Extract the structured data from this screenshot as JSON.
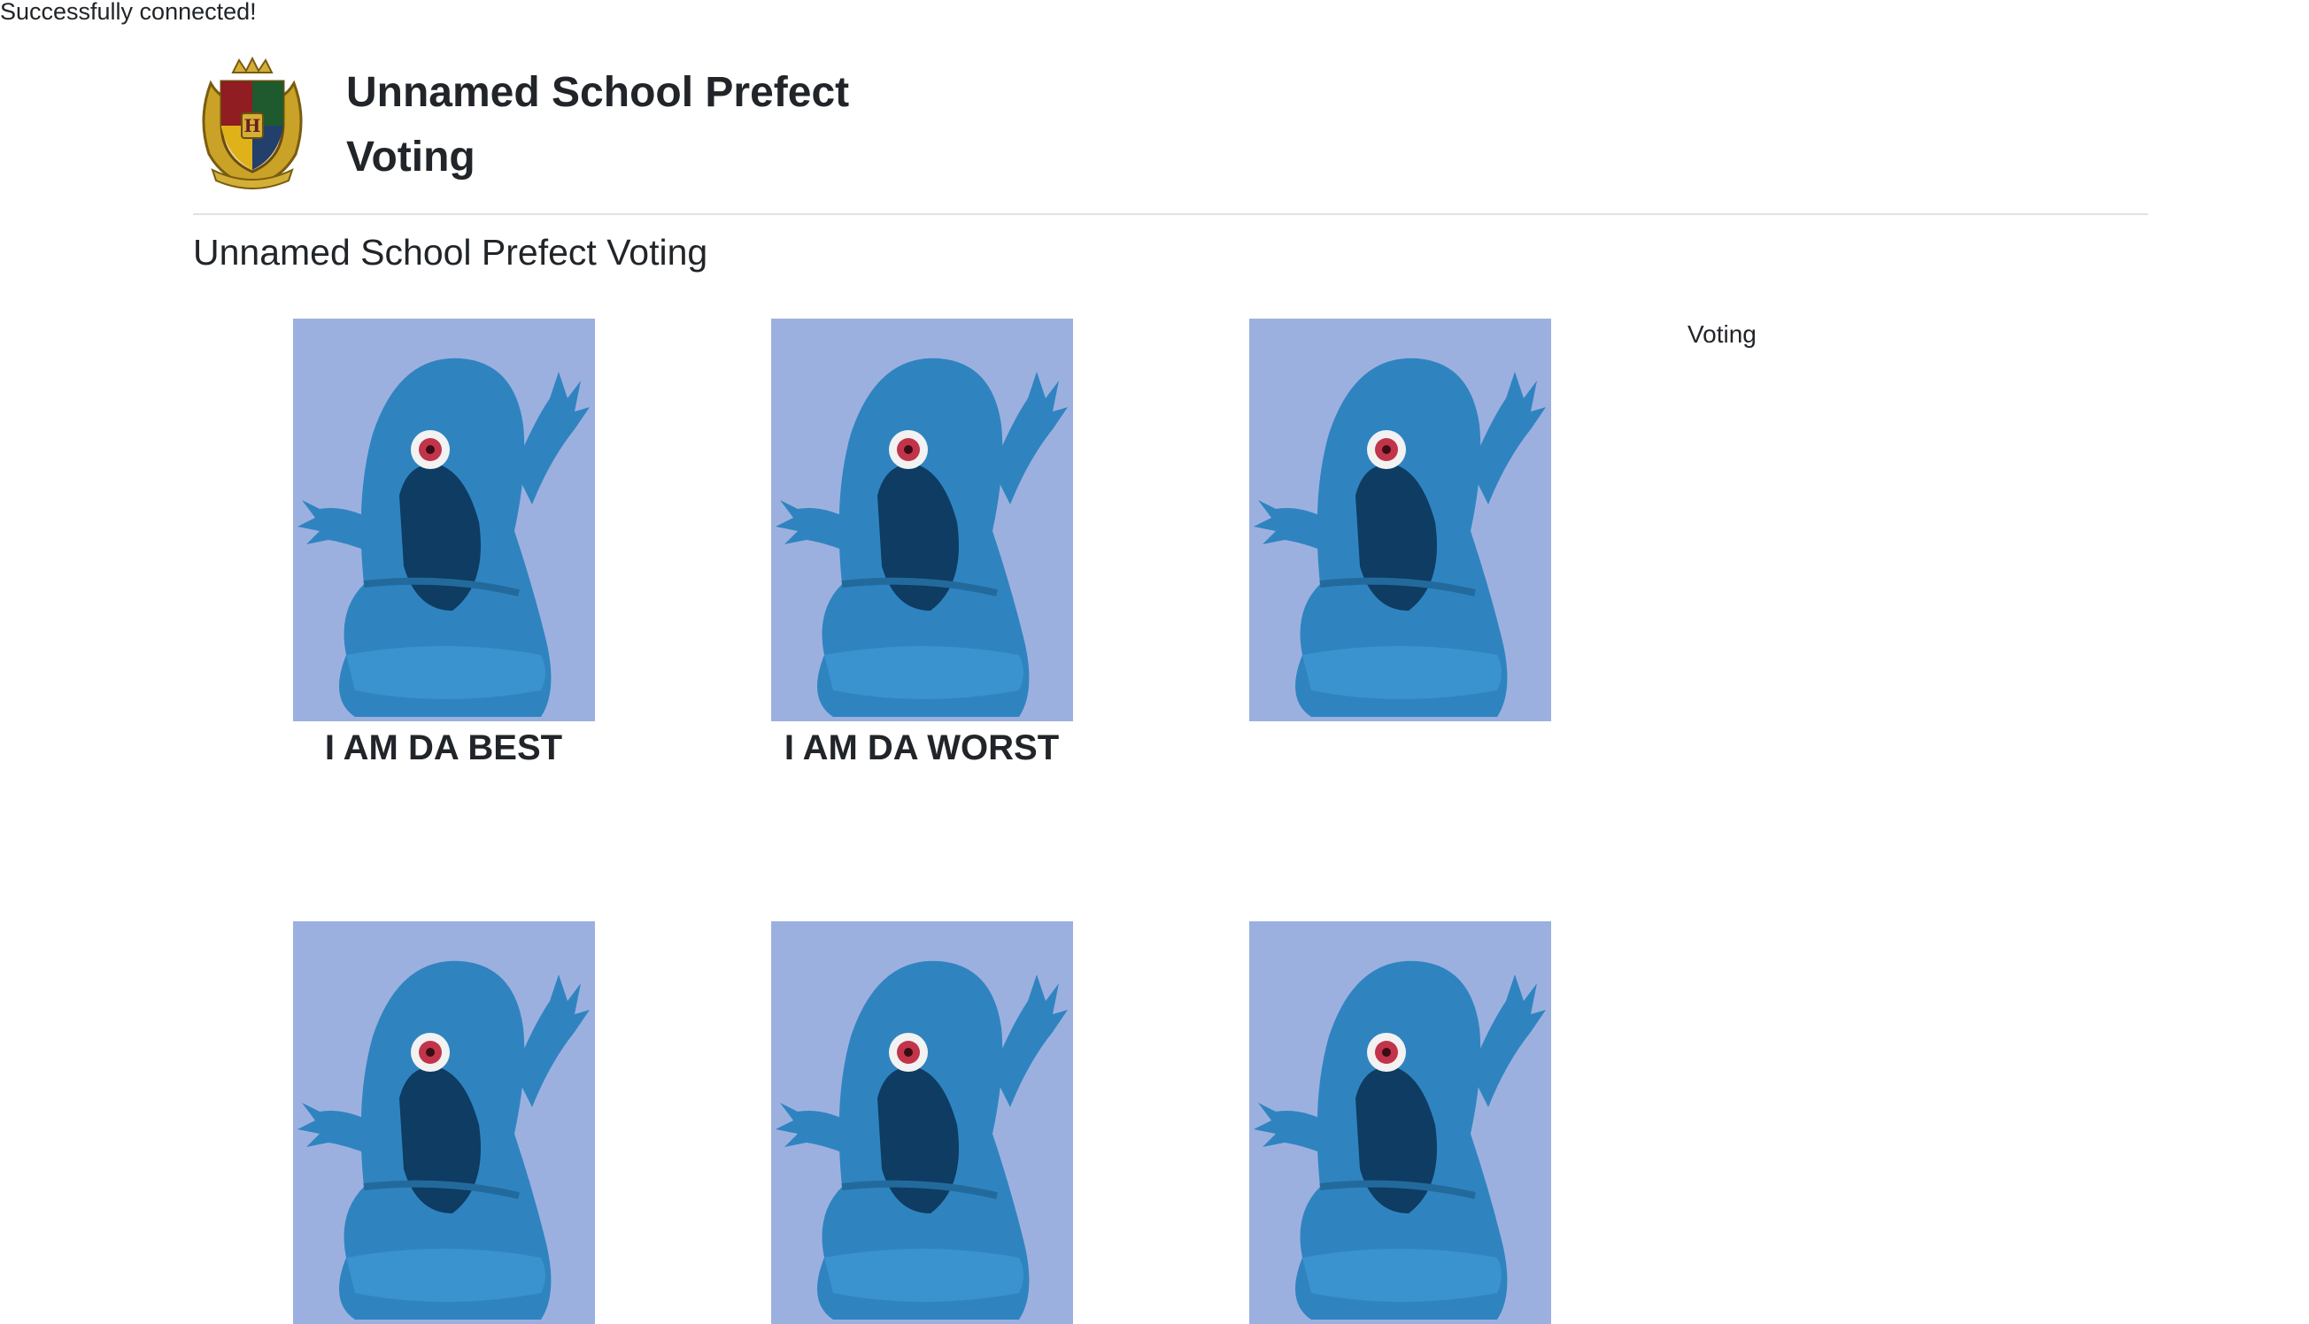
{
  "status": {
    "message": "Successfully connected!"
  },
  "header": {
    "title": "Unnamed School Prefect Voting",
    "logo_icon": "school-crest-icon"
  },
  "main": {
    "heading": "Unnamed School Prefect Voting",
    "side_label": "Voting",
    "candidates": [
      {
        "name": "I AM DA BEST",
        "photo_icon": "blue-one-eyed-blob-photo"
      },
      {
        "name": "I AM DA WORST",
        "photo_icon": "blue-one-eyed-blob-photo"
      },
      {
        "name": "",
        "photo_icon": "blue-one-eyed-blob-photo"
      },
      {
        "name": "",
        "photo_icon": "blue-one-eyed-blob-photo"
      },
      {
        "name": "",
        "photo_icon": "blue-one-eyed-blob-photo"
      },
      {
        "name": "",
        "photo_icon": "blue-one-eyed-blob-photo"
      }
    ]
  },
  "colors": {
    "photo_background": "#9cb0e0",
    "blob_body": "#2f84c0",
    "text": "#212529",
    "divider": "#dee2e6"
  }
}
